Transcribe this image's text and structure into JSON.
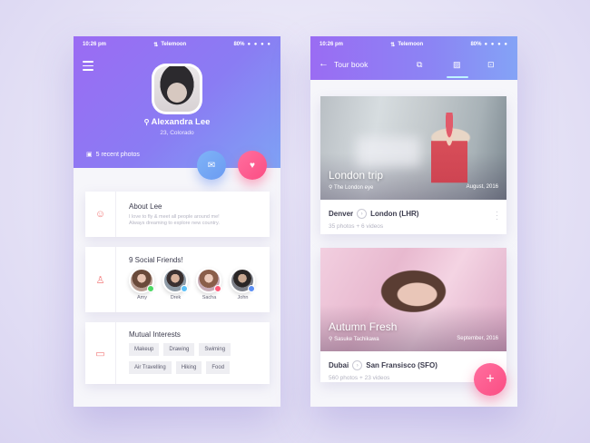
{
  "colors": {
    "header_gradient_start": "#9b6bf3",
    "header_gradient_end": "#7fa3f5",
    "mail_button": "#6b9bf2",
    "heart_button": "#fb4d83",
    "card_icon": "#f27a7a"
  },
  "left_phone": {
    "status": {
      "time": "10:26 pm",
      "carrier": "Telemoon",
      "battery": "80%",
      "signal": "● ● ● ●"
    },
    "profile": {
      "name": "Alexandra Lee",
      "location": "23, Colorado",
      "recent_photos": "5 recent photos"
    },
    "about": {
      "title": "About Lee",
      "line1": "I love to fly & meet all people around me!",
      "line2": "Always dreaming to explore new country."
    },
    "friends": {
      "title": "9 Social Friends!",
      "items": [
        {
          "name": "Amy",
          "badge_color": "#4cd964"
        },
        {
          "name": "Drek",
          "badge_color": "#5bc0f8"
        },
        {
          "name": "Sacha",
          "badge_color": "#ff5a78"
        },
        {
          "name": "John",
          "badge_color": "#5b8ef5"
        }
      ]
    },
    "interests": {
      "title": "Mutual Interests",
      "tags": [
        "Makeup",
        "Drawing",
        "Swiming",
        "Air Travelling",
        "Hiking",
        "Food"
      ]
    }
  },
  "right_phone": {
    "status": {
      "time": "10:26 pm",
      "carrier": "Telemoon",
      "battery": "80%",
      "signal": "● ● ● ●"
    },
    "header": {
      "title": "Tour book"
    },
    "trips": [
      {
        "title": "London trip",
        "subtitle": "The London eye",
        "date": "August, 2016",
        "from": "Denver",
        "to": "London (LHR)",
        "meta": "35 photos + 6 videos"
      },
      {
        "title": "Autumn Fresh",
        "subtitle": "Sasuke Tachikawa",
        "date": "September, 2016",
        "from": "Dubai",
        "to": "San Fransisco (SFO)",
        "meta": "560 photos + 23 videos"
      }
    ]
  }
}
